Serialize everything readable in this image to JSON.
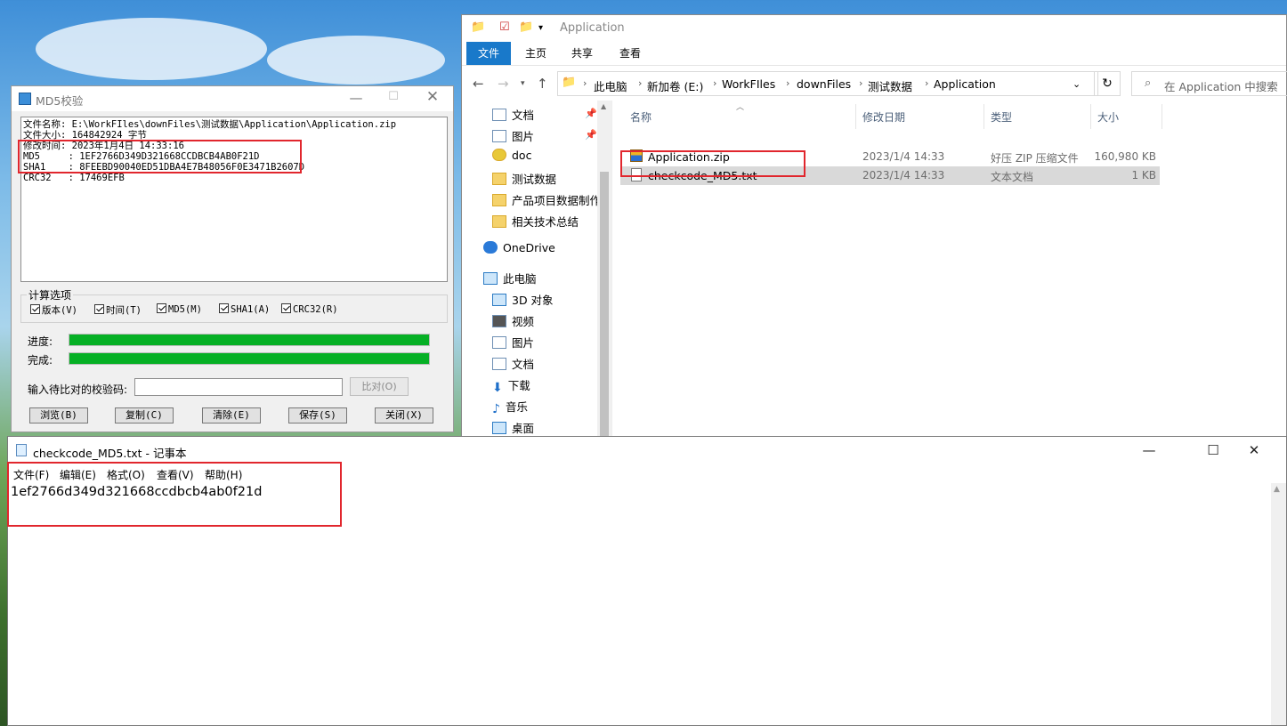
{
  "explorer": {
    "title": "Application",
    "tabs": [
      "文件",
      "主页",
      "共享",
      "查看"
    ],
    "breadcrumbs": [
      "此电脑",
      "新加卷 (E:)",
      "WorkFIles",
      "downFiles",
      "测试数据",
      "Application"
    ],
    "search_placeholder": "在 Application 中搜索",
    "nav": {
      "quick_access": [
        {
          "label": "文档",
          "icon": "documents-icon",
          "pinned": true
        },
        {
          "label": "图片",
          "icon": "pictures-icon",
          "pinned": true
        },
        {
          "label": "doc",
          "icon": "folder-check-icon",
          "pinned": false
        },
        {
          "label": "测试数据",
          "icon": "folder-icon",
          "pinned": false
        },
        {
          "label": "产品项目数据制作",
          "icon": "folder-icon",
          "pinned": false
        },
        {
          "label": "相关技术总结",
          "icon": "folder-icon",
          "pinned": false
        }
      ],
      "onedrive": "OneDrive",
      "this_pc": "此电脑",
      "pc_items": [
        {
          "label": "3D 对象",
          "icon": "3d-objects-icon"
        },
        {
          "label": "视频",
          "icon": "videos-icon"
        },
        {
          "label": "图片",
          "icon": "pictures-icon"
        },
        {
          "label": "文档",
          "icon": "documents-icon"
        },
        {
          "label": "下载",
          "icon": "downloads-icon"
        },
        {
          "label": "音乐",
          "icon": "music-icon"
        },
        {
          "label": "桌面",
          "icon": "desktop-icon"
        }
      ]
    },
    "columns": {
      "name": "名称",
      "modified": "修改日期",
      "type": "类型",
      "size": "大小"
    },
    "files": [
      {
        "name": "Application.zip",
        "modified": "2023/1/4 14:33",
        "type": "好压 ZIP 压缩文件",
        "size": "160,980 KB",
        "icon": "zip-icon"
      },
      {
        "name": "checkcode_MD5.txt",
        "modified": "2023/1/4 14:33",
        "type": "文本文档",
        "size": "1 KB",
        "icon": "text-file-icon"
      }
    ]
  },
  "md5": {
    "title": "MD5校验",
    "info_lines": [
      "文件名称: E:\\WorkFIles\\downFiles\\测试数据\\Application\\Application.zip",
      "文件大小: 164842924 字节",
      "修改时间: 2023年1月4日 14:33:16",
      "MD5     : 1EF2766D349D321668CCDBCB4AB0F21D",
      "SHA1    : 8FEEBD90040ED51DBA4E7B48056F0E3471B2607D",
      "CRC32   : 17469EFB"
    ],
    "options_label": "计算选项",
    "options": [
      "版本(V)",
      "时间(T)",
      "MD5(M)",
      "SHA1(A)",
      "CRC32(R)"
    ],
    "progress_label": "进度:",
    "complete_label": "完成:",
    "progress": 1.0,
    "complete": 1.0,
    "compare_label": "输入待比对的校验码:",
    "compare_value": "",
    "compare_button": "比对(O)",
    "buttons": [
      "浏览(B)",
      "复制(C)",
      "清除(E)",
      "保存(S)",
      "关闭(X)"
    ]
  },
  "notepad": {
    "title": "checkcode_MD5.txt - 记事本",
    "menu": [
      "文件(F)",
      "编辑(E)",
      "格式(O)",
      "查看(V)",
      "帮助(H)"
    ],
    "content": "1ef2766d349d321668ccdbcb4ab0f21d"
  },
  "colors": {
    "highlight": "#e1262d",
    "progress_fill": "#06b025",
    "ribbon_file": "#1979ca"
  }
}
